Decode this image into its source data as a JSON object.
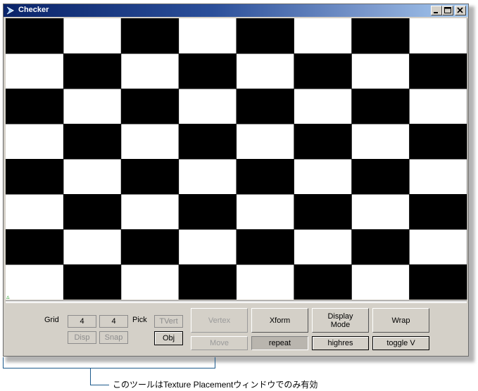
{
  "window": {
    "title": "Checker",
    "controls": [
      "minimize-icon",
      "maximize-icon",
      "close-icon"
    ]
  },
  "checker": {
    "columns": 8,
    "rows": 8,
    "dark_color": "#000000",
    "light_color": "#ffffff"
  },
  "panel": {
    "grid_label": "Grid",
    "grid_u": "4",
    "grid_v": "4",
    "pick_label": "Pick",
    "tvert_label": "TVert",
    "obj_label": "Obj",
    "disp_label": "Disp",
    "snap_label": "Snap",
    "vertex_label": "Vertex",
    "move_label": "Move",
    "xform_label": "Xform",
    "repeat_label": "repeat",
    "display_mode_line1": "Display",
    "display_mode_line2": "Mode",
    "highres_label": "highres",
    "wrap_label": "Wrap",
    "toggle_v_label": "toggle V"
  },
  "annotation": {
    "text": "このツールはTexture Placementウィンドウでのみ有効"
  }
}
